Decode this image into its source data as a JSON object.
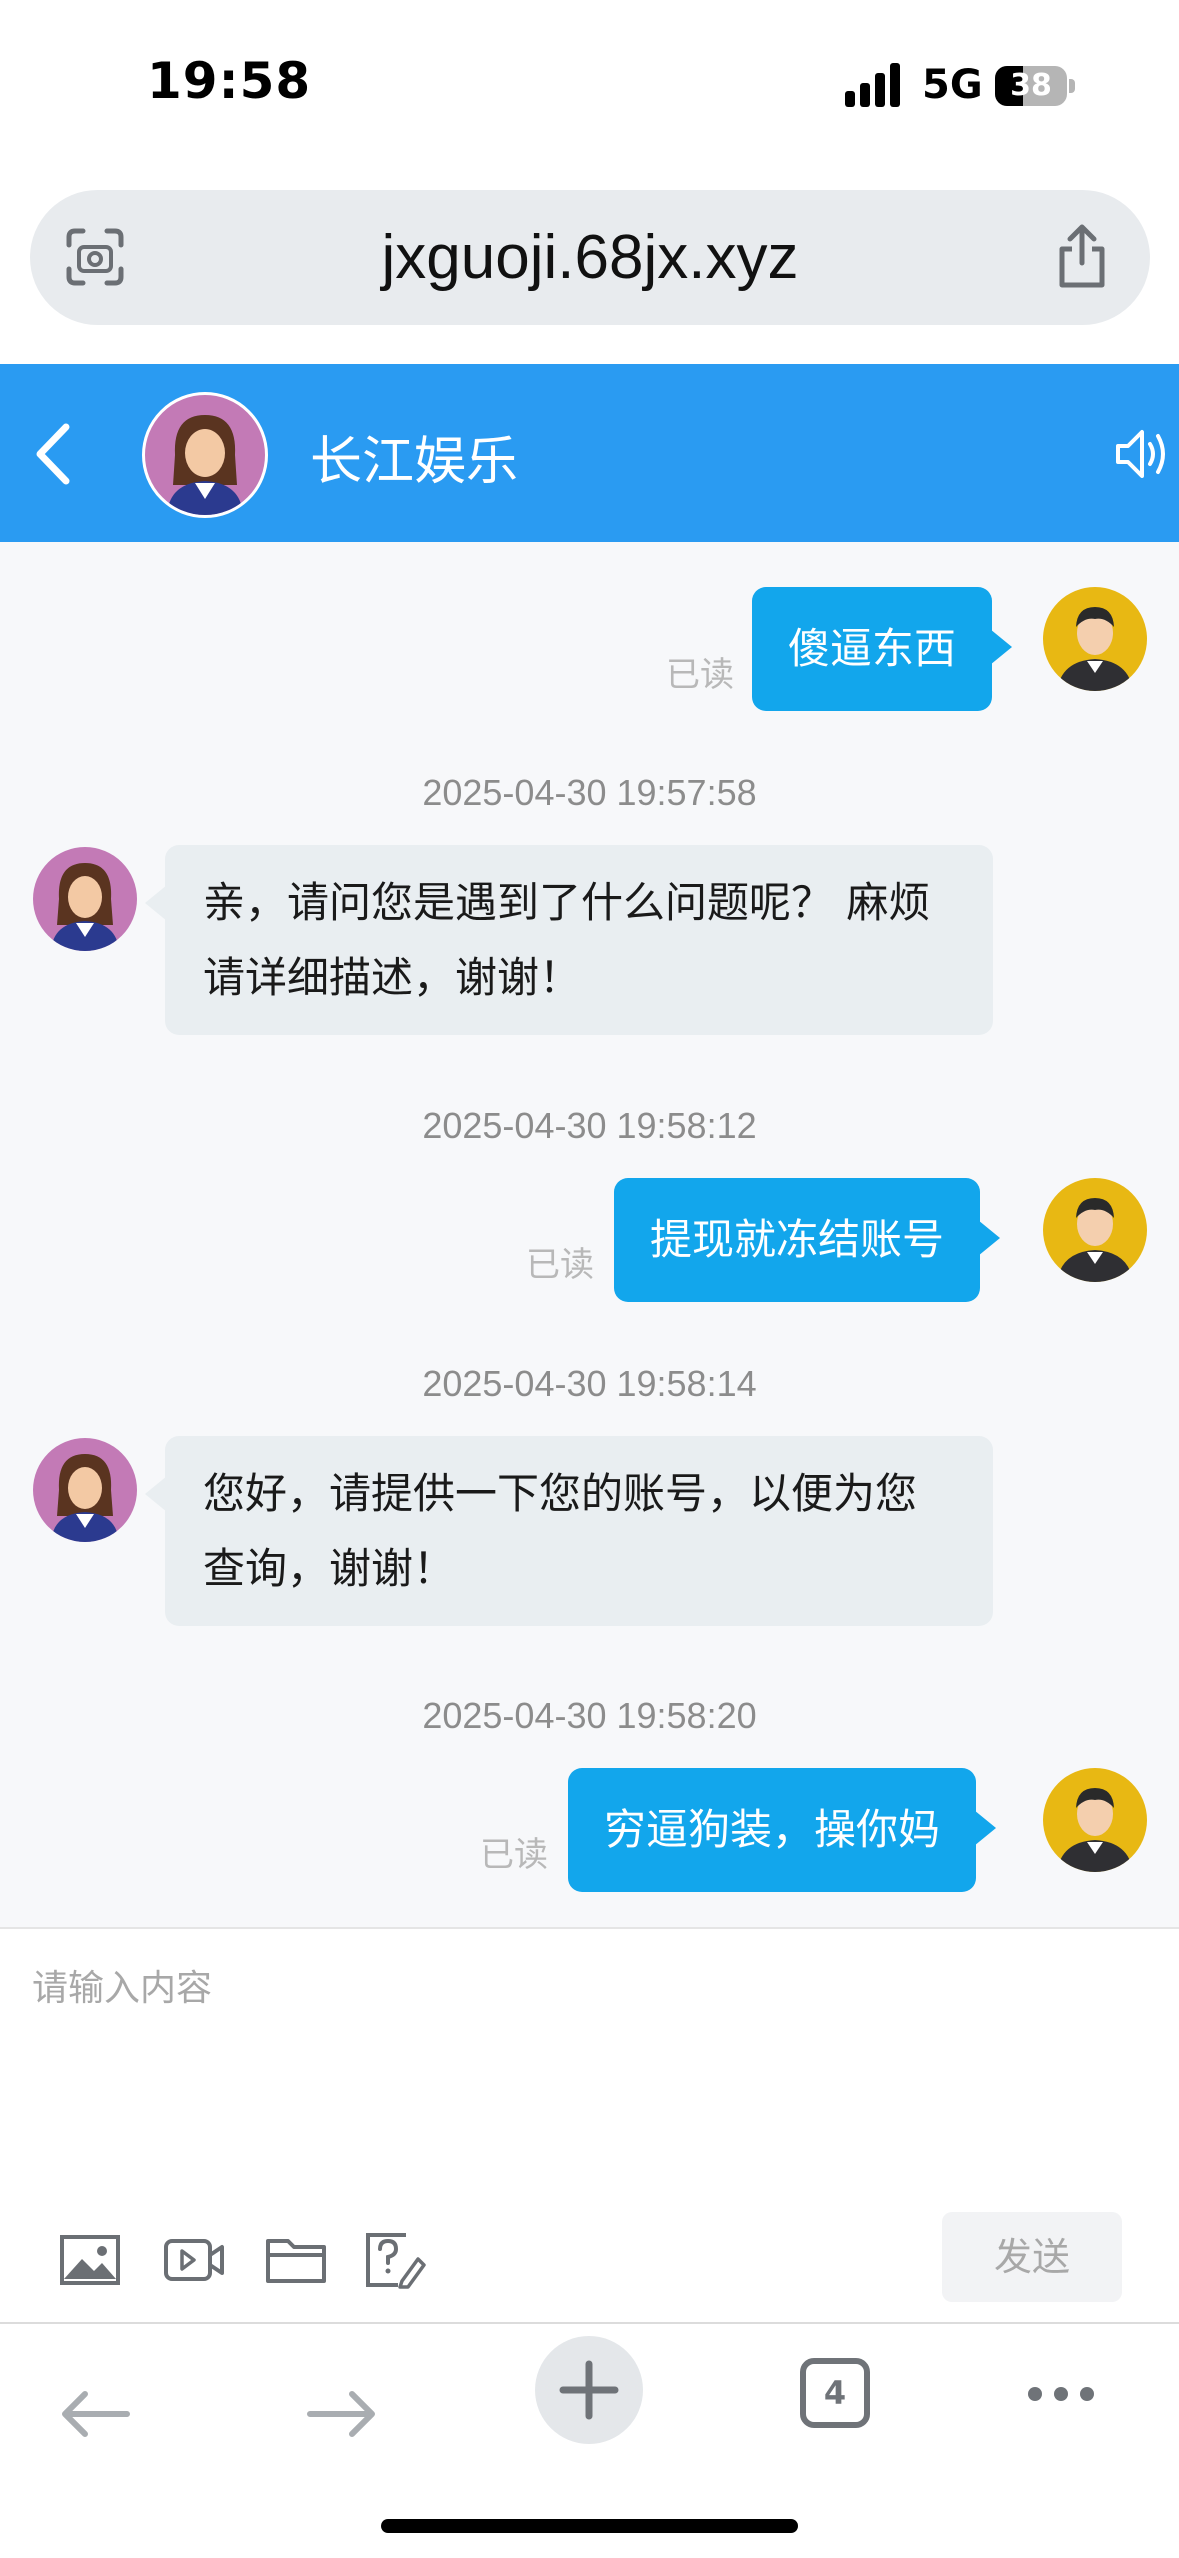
{
  "status_bar": {
    "time": "19:58",
    "network": "5G",
    "battery": "38"
  },
  "browser": {
    "url": "jxguoji.68jx.xyz",
    "tab_count": "4"
  },
  "chat_header": {
    "title": "长江娱乐"
  },
  "messages": [
    {
      "sender": "me",
      "read_label": "已读",
      "text": "傻逼东西"
    },
    {
      "timestamp": "2025-04-30 19:57:58",
      "sender": "agent",
      "text": "亲，请问您是遇到了什么问题呢？ 麻烦请详细描述，谢谢！"
    },
    {
      "timestamp": "2025-04-30 19:58:12",
      "sender": "me",
      "read_label": "已读",
      "text": "提现就冻结账号"
    },
    {
      "timestamp": "2025-04-30 19:58:14",
      "sender": "agent",
      "text": "您好，请提供一下您的账号，以便为您查询，谢谢！"
    },
    {
      "timestamp": "2025-04-30 19:58:20",
      "sender": "me",
      "read_label": "已读",
      "text": "穷逼狗装，操你妈"
    }
  ],
  "composer": {
    "placeholder": "请输入内容",
    "send_label": "发送",
    "tools": [
      "image-icon",
      "video-icon",
      "folder-icon",
      "question-edit-icon"
    ]
  },
  "colors": {
    "header_blue": "#2a9bf2",
    "bubble_blue": "#12a6ec",
    "bubble_grey": "#e9eef1"
  }
}
